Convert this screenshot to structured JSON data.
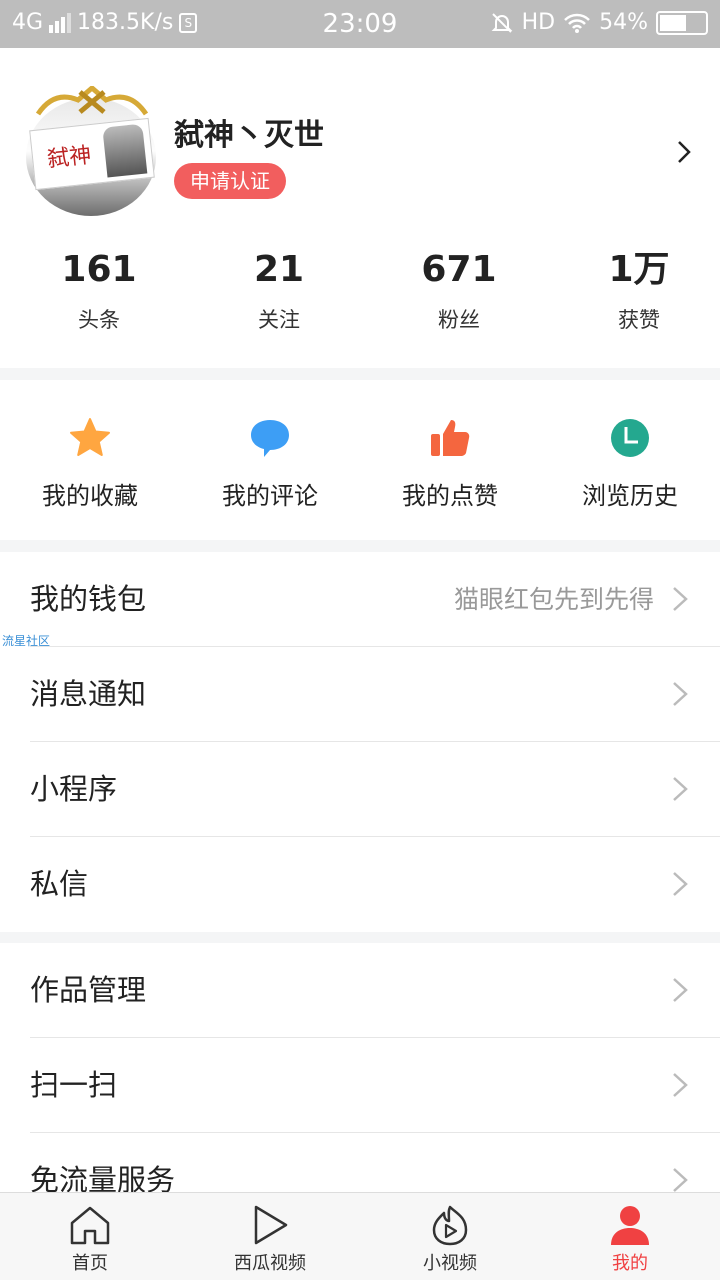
{
  "status_bar": {
    "network": "4G",
    "speed": "183.5K/s",
    "speed_icon_glyph": "S",
    "time": "23:09",
    "hd": "HD",
    "battery": "54%"
  },
  "profile": {
    "avatar_text": "弑神",
    "username": "弑神丶灭世",
    "certify_label": "申请认证",
    "stats": [
      {
        "value": "161",
        "label": "头条"
      },
      {
        "value": "21",
        "label": "关注"
      },
      {
        "value": "671",
        "label": "粉丝"
      },
      {
        "value": "1万",
        "label": "获赞"
      }
    ]
  },
  "quick_actions": [
    {
      "label": "我的收藏",
      "icon": "star-icon",
      "color": "#ffa640"
    },
    {
      "label": "我的评论",
      "icon": "comment-bubble-icon",
      "color": "#3d9ef5"
    },
    {
      "label": "我的点赞",
      "icon": "thumbs-up-icon",
      "color": "#f4663f"
    },
    {
      "label": "浏览历史",
      "icon": "clock-icon",
      "color": "#24a88f"
    }
  ],
  "menu_group_1": {
    "wallet_label": "我的钱包",
    "wallet_hint": "猫眼红包先到先得",
    "notifications_label": "消息通知",
    "mini_programs_label": "小程序",
    "messages_label": "私信"
  },
  "watermark": "流星社区",
  "menu_group_2": {
    "works_label": "作品管理",
    "scan_label": "扫一扫",
    "free_data_label": "免流量服务"
  },
  "tabbar": {
    "home": "首页",
    "xigua": "西瓜视频",
    "short_video": "小视频",
    "mine": "我的",
    "active_color": "#f04142"
  }
}
